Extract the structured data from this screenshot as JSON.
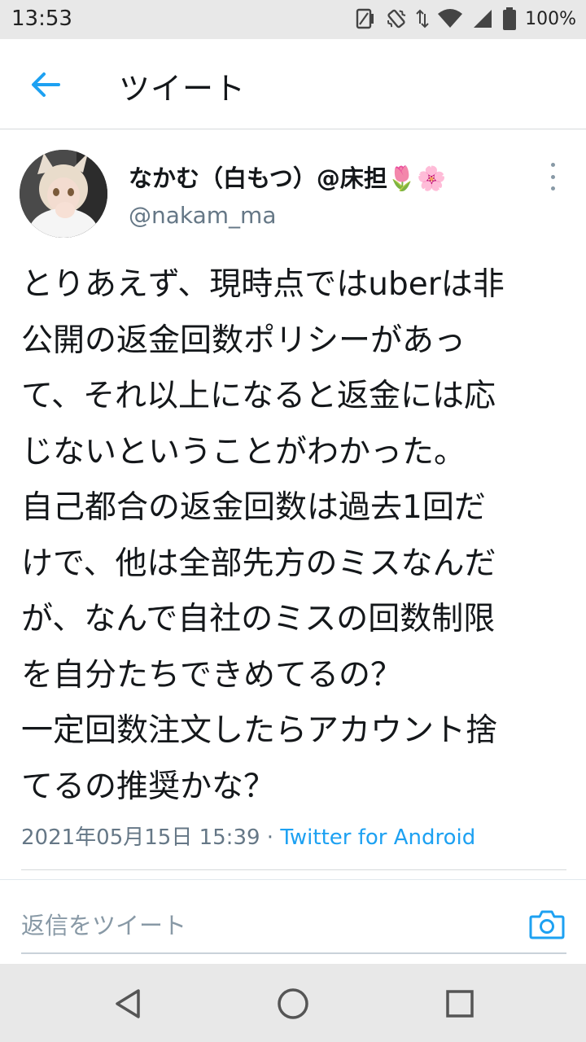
{
  "status_bar": {
    "time": "13:53",
    "battery_percent": "100%",
    "icons": [
      "sim-icon",
      "vibrate-icon",
      "data-arrows-icon",
      "wifi-icon",
      "signal-icon",
      "battery-icon"
    ]
  },
  "header": {
    "title": "ツイート",
    "back_icon": "arrow-left-icon",
    "accent_color": "#1da1f2"
  },
  "tweet": {
    "author_name": "なかむ（白もつ）@床担",
    "author_emoji": "🌷🌸",
    "handle": "@nakam_ma",
    "body_lines": [
      "とりあえず、現時点ではuberは非",
      "公開の返金回数ポリシーがあっ",
      "て、それ以上になると返金には応",
      "じないということがわかった。",
      "自己都合の返金回数は過去1回だ",
      "けで、他は全部先方のミスなんだ",
      "が、なんで自社のミスの回数制限",
      "を自分たちできめてるの？",
      "一定回数注文したらアカウント捨",
      "てるの推奨かな？"
    ],
    "timestamp": "2021年05月15日 15:39",
    "separator": " · ",
    "source": "Twitter for Android"
  },
  "reply": {
    "placeholder": "返信をツイート",
    "camera_icon": "camera-icon"
  },
  "nav_bar": {
    "buttons": [
      "back-triangle-icon",
      "home-circle-icon",
      "recents-square-icon"
    ]
  }
}
